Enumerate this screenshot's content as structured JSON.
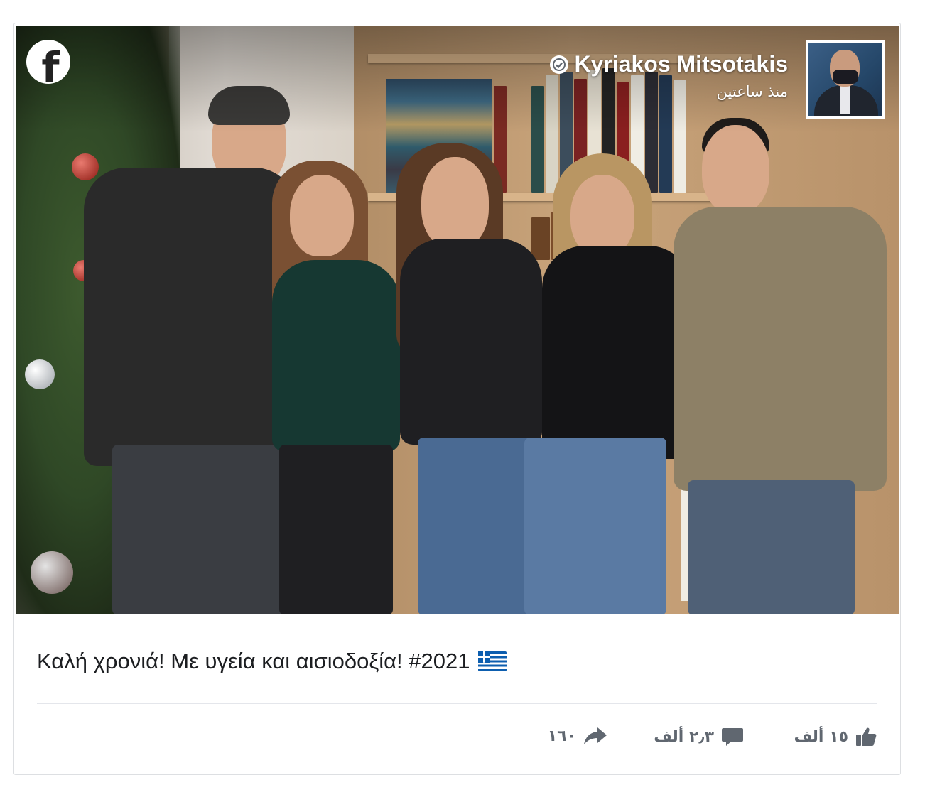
{
  "post": {
    "author_name": "Kyriakos Mitsotakis",
    "timestamp": "منذ ساعتين",
    "caption_text": "Καλή χρονιά! Με υγεία και αισιοδοξία! #2021",
    "caption_flag": "greece-flag-icon"
  },
  "stats": {
    "likes": "١٥ ألف",
    "comments": "٢٫٣ ألف",
    "shares": "١٦٠"
  },
  "icons": {
    "brand": "facebook-icon",
    "verified": "verified-badge-icon",
    "like": "thumbs-up-icon",
    "comment": "comment-bubble-icon",
    "share": "share-arrow-icon"
  },
  "colors": {
    "text": "#1c1e21",
    "muted": "#606770",
    "divider": "#e4e6eb",
    "card_border": "#dddfe2"
  }
}
